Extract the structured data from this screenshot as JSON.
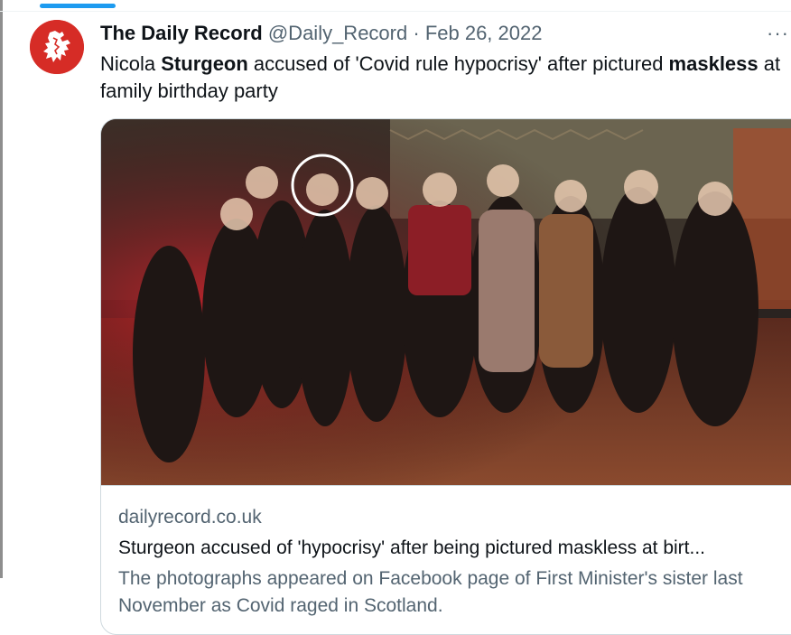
{
  "tweet": {
    "author_name": "The Daily Record",
    "handle": "@Daily_Record",
    "separator": "·",
    "date": "Feb 26, 2022",
    "more": "···",
    "text_parts": [
      {
        "t": "Nicola ",
        "bold": false
      },
      {
        "t": "Sturgeon",
        "bold": true
      },
      {
        "t": " accused of 'Covid rule hypocrisy' after pictured ",
        "bold": false
      },
      {
        "t": "maskless",
        "bold": true
      },
      {
        "t": " at family birthday party",
        "bold": false
      }
    ]
  },
  "card": {
    "domain": "dailyrecord.co.uk",
    "title": "Sturgeon accused of 'hypocrisy' after being pictured maskless at birt...",
    "description": "The photographs appeared on Facebook page of First Minister's sister last November as Covid raged in Scotland."
  },
  "icons": {
    "avatar": "lion-rampant-logo-icon",
    "more": "more-icon"
  },
  "colors": {
    "accent": "#1d9bf0",
    "avatar_red": "#d62c26",
    "secondary_text": "#536471",
    "primary_text": "#0f1419"
  }
}
